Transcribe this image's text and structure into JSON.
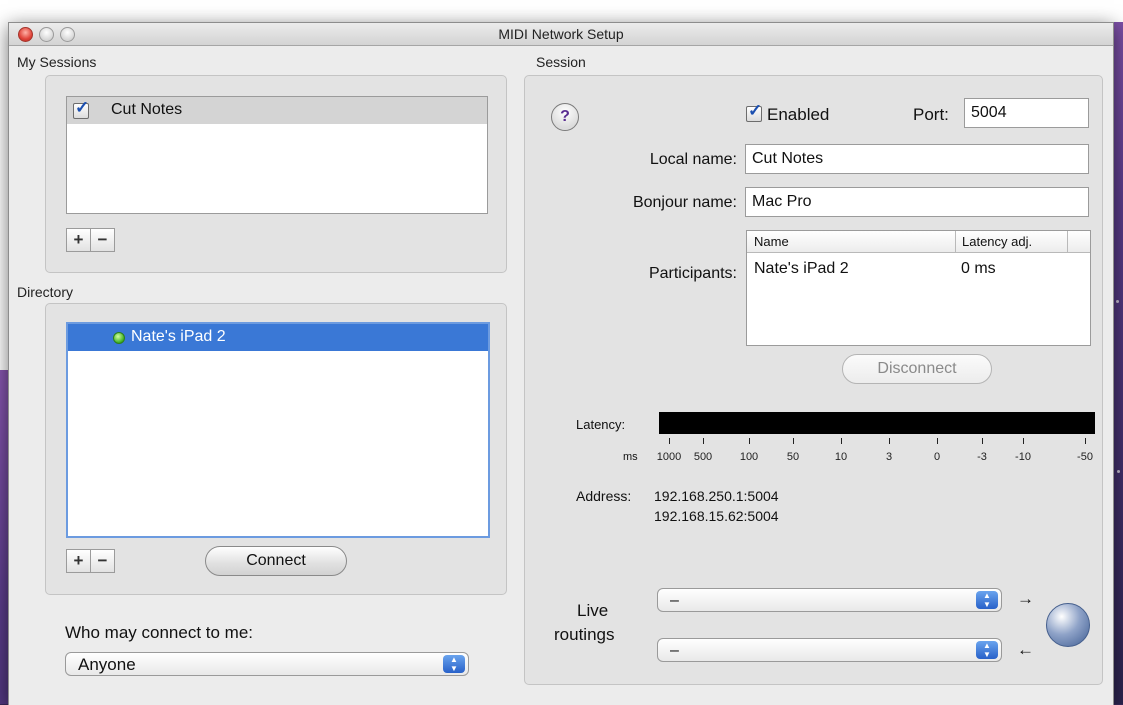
{
  "window": {
    "title": "MIDI Network Setup"
  },
  "my_sessions": {
    "label": "My Sessions",
    "items": [
      {
        "name": "Cut Notes",
        "checked": true
      }
    ],
    "add_label": "+",
    "remove_label": "−"
  },
  "directory": {
    "label": "Directory",
    "items": [
      {
        "name": "Nate's iPad 2",
        "status": "online"
      }
    ],
    "add_label": "+",
    "remove_label": "−",
    "connect_label": "Connect"
  },
  "who_may_connect": {
    "label": "Who may connect to me:",
    "selected": "Anyone"
  },
  "session": {
    "label": "Session",
    "help_label": "?",
    "enabled_label": "Enabled",
    "enabled": true,
    "port_label": "Port:",
    "port_value": "5004",
    "local_name_label": "Local name:",
    "local_name_value": "Cut Notes",
    "bonjour_name_label": "Bonjour name:",
    "bonjour_name_value": "Mac Pro",
    "participants_label": "Participants:",
    "participants": {
      "columns": [
        "Name",
        "Latency adj."
      ],
      "rows": [
        [
          "Nate's iPad 2",
          "0 ms"
        ]
      ]
    },
    "disconnect_label": "Disconnect",
    "latency_label": "Latency:",
    "latency_units": "ms",
    "latency_scale": [
      "1000",
      "500",
      "100",
      "50",
      "10",
      "3",
      "0",
      "-3",
      "-10",
      "-50"
    ],
    "address_label": "Address:",
    "addresses": [
      "192.168.250.1:5004",
      "192.168.15.62:5004"
    ],
    "live_routings_label_1": "Live",
    "live_routings_label_2": "routings",
    "routing_in": "–",
    "routing_out": "–"
  },
  "colors": {
    "selection": "#3a78d6",
    "window_bg": "#ececec",
    "led": "#3bb022"
  }
}
